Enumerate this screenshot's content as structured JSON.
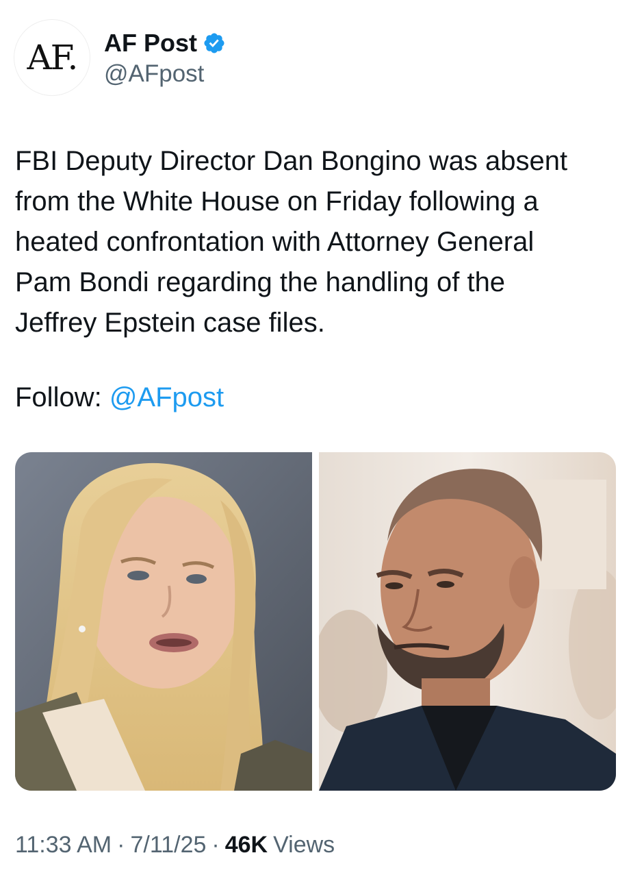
{
  "author": {
    "avatar_text": "AF.",
    "display_name": "AF Post",
    "handle": "@AFpost",
    "verified": true
  },
  "tweet": {
    "text": "FBI Deputy Director Dan Bongino was absent\nfrom the White House on Friday following a\nheated confrontation with Attorney General\nPam Bondi regarding the handling of the\nJeffrey Epstein case files.",
    "follow_prefix": "Follow: ",
    "follow_mention": "@AFpost"
  },
  "meta": {
    "time": "11:33 AM",
    "separator": "·",
    "date": "7/11/25",
    "views_count": "46K",
    "views_label": "Views"
  },
  "colors": {
    "link": "#1d9bf0",
    "secondary_text": "#536471",
    "verified_badge": "#1d9bf0"
  }
}
